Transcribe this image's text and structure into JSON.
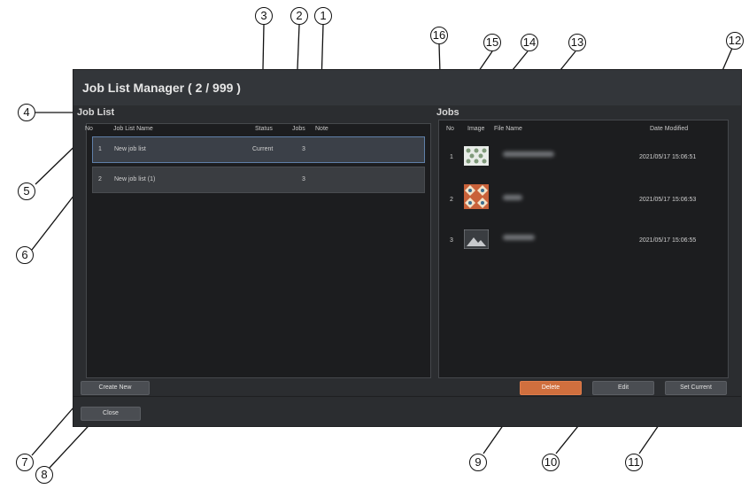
{
  "window": {
    "title": "Job List Manager ( 2 / 999 )"
  },
  "job_list": {
    "section_label": "Job List",
    "columns": {
      "no": "No",
      "name": "Job List Name",
      "status": "Status",
      "jobs": "Jobs",
      "note": "Note"
    },
    "rows": [
      {
        "no": "1",
        "name": "New job list",
        "status": "Current",
        "jobs": "3",
        "note": ""
      },
      {
        "no": "2",
        "name": "New job list (1)",
        "status": "",
        "jobs": "3",
        "note": ""
      }
    ]
  },
  "jobs": {
    "section_label": "Jobs",
    "columns": {
      "no": "No",
      "image": "Image",
      "file_name": "File Name",
      "date_modified": "Date Modified"
    },
    "rows": [
      {
        "no": "1",
        "thumb": "pattern-thumbnail-icon",
        "date": "2021/05/17 15:06:51"
      },
      {
        "no": "2",
        "thumb": "tile-pattern-thumbnail-icon",
        "date": "2021/05/17 15:06:53"
      },
      {
        "no": "3",
        "thumb": "image-placeholder-icon",
        "date": "2021/05/17 15:06:55"
      }
    ]
  },
  "buttons": {
    "create_new": "Create New",
    "close": "Close",
    "delete": "Delete",
    "edit": "Edit",
    "set_current": "Set Current"
  },
  "colors": {
    "accent_button": "#d06f3e",
    "selection_border": "#5f7fa8",
    "window_bg": "#2b2d30"
  },
  "callouts": [
    "1",
    "2",
    "3",
    "4",
    "5",
    "6",
    "7",
    "8",
    "9",
    "10",
    "11",
    "12",
    "13",
    "14",
    "15",
    "16"
  ]
}
